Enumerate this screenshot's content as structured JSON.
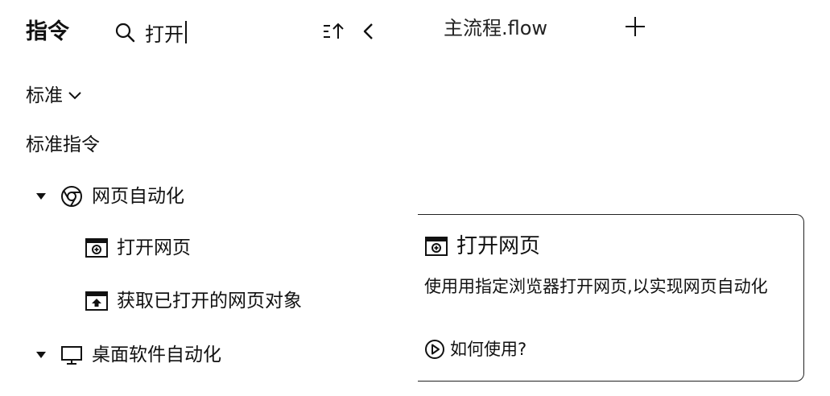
{
  "header": {
    "title": "指令",
    "search_value": "打开",
    "tab_label": "主流程.flow"
  },
  "filter": {
    "label": "标准"
  },
  "section": {
    "title": "标准指令"
  },
  "tree": [
    {
      "label": "网页自动化",
      "icon": "chrome-icon",
      "expanded": true,
      "children": [
        {
          "label": "打开网页",
          "icon": "browser-open-icon"
        },
        {
          "label": "获取已打开的网页对象",
          "icon": "browser-upload-icon"
        }
      ]
    },
    {
      "label": "桌面软件自动化",
      "icon": "monitor-icon",
      "expanded": true
    }
  ],
  "tooltip": {
    "title": "打开网页",
    "description": "使用用指定浏览器打开网页,以实现网页自动化",
    "link_label": "如何使用?"
  },
  "colors": {
    "text": "#111111",
    "border": "#222222",
    "background": "#ffffff"
  }
}
